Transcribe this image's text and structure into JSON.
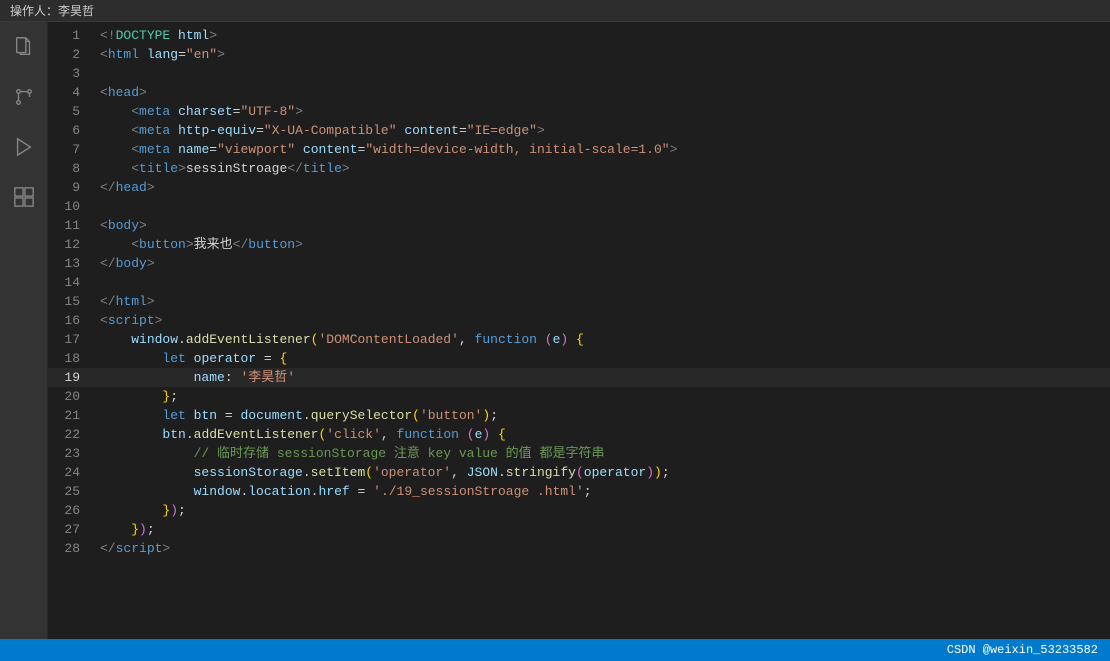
{
  "topbar": {
    "author_label": "操作人：李昊哲"
  },
  "activity": {
    "icons": [
      "files",
      "source-control",
      "debug",
      "extensions"
    ]
  },
  "lines": [
    {
      "num": 1,
      "content": "<span class='tag-angle'>&lt;!</span><span class='tag-name'>DOCTYPE</span> <span class='attr'>html</span><span class='tag-angle'>&gt;</span>"
    },
    {
      "num": 2,
      "content": "<span class='tag-angle'>&lt;</span><span class='tag-name-html'>html</span> <span class='attr'>lang</span><span class='op'>=</span><span class='val-str'>\"en\"</span><span class='tag-angle'>&gt;</span>"
    },
    {
      "num": 3,
      "content": ""
    },
    {
      "num": 4,
      "content": "<span class='tag-angle'>&lt;</span><span class='tag-name-html'>head</span><span class='tag-angle'>&gt;</span>"
    },
    {
      "num": 5,
      "content": "    <span class='tag-angle'>&lt;</span><span class='tag-name-html'>meta</span> <span class='attr'>charset</span><span class='op'>=</span><span class='val-str'>\"UTF-8\"</span><span class='tag-angle'>&gt;</span>"
    },
    {
      "num": 6,
      "content": "    <span class='tag-angle'>&lt;</span><span class='tag-name-html'>meta</span> <span class='attr'>http-equiv</span><span class='op'>=</span><span class='val-str'>\"X-UA-Compatible\"</span> <span class='attr'>content</span><span class='op'>=</span><span class='val-str'>\"IE=edge\"</span><span class='tag-angle'>&gt;</span>"
    },
    {
      "num": 7,
      "content": "    <span class='tag-angle'>&lt;</span><span class='tag-name-html'>meta</span> <span class='attr'>name</span><span class='op'>=</span><span class='val-str'>\"viewport\"</span> <span class='attr'>content</span><span class='op'>=</span><span class='val-str'>\"width=device-width, initial-scale=1.0\"</span><span class='tag-angle'>&gt;</span>"
    },
    {
      "num": 8,
      "content": "    <span class='tag-angle'>&lt;</span><span class='tag-name-html'>title</span><span class='tag-angle'>&gt;</span><span class='plain'>sessinStroage</span><span class='tag-angle'>&lt;/</span><span class='tag-name-html'>title</span><span class='tag-angle'>&gt;</span>"
    },
    {
      "num": 9,
      "content": "<span class='tag-angle'>&lt;/</span><span class='tag-name-html'>head</span><span class='tag-angle'>&gt;</span>"
    },
    {
      "num": 10,
      "content": ""
    },
    {
      "num": 11,
      "content": "<span class='tag-angle'>&lt;</span><span class='tag-name-html'>body</span><span class='tag-angle'>&gt;</span>"
    },
    {
      "num": 12,
      "content": "    <span class='tag-angle'>&lt;</span><span class='tag-name-html'>button</span><span class='tag-angle'>&gt;</span><span class='plain'>我来也</span><span class='tag-angle'>&lt;/</span><span class='tag-name-html'>button</span><span class='tag-angle'>&gt;</span>"
    },
    {
      "num": 13,
      "content": "<span class='tag-angle'>&lt;/</span><span class='tag-name-html'>body</span><span class='tag-angle'>&gt;</span>"
    },
    {
      "num": 14,
      "content": ""
    },
    {
      "num": 15,
      "content": "<span class='tag-angle'>&lt;/</span><span class='tag-name-html'>html</span><span class='tag-angle'>&gt;</span>"
    },
    {
      "num": 16,
      "content": "<span class='tag-angle'>&lt;</span><span class='tag-name-html'>script</span><span class='tag-angle'>&gt;</span>"
    },
    {
      "num": 17,
      "content": "    <span class='var'>window</span><span class='plain'>.</span><span class='fn'>addEventListener</span><span class='bracket'>(</span><span class='val-str'>'DOMContentLoaded'</span><span class='plain'>,</span> <span class='kw'>function</span> <span class='bracket2'>(</span><span class='var'>e</span><span class='bracket2'>)</span> <span class='bracket'>{</span>"
    },
    {
      "num": 18,
      "content": "        <span class='kw'>let</span> <span class='var'>operator</span> <span class='op'>=</span> <span class='bracket'>{</span>"
    },
    {
      "num": 19,
      "content": "            <span class='prop'>name</span><span class='plain'>:</span> <span class='val-str'>'李昊哲'</span>",
      "highlighted": true
    },
    {
      "num": 20,
      "content": "        <span class='bracket'>}</span><span class='plain'>;</span>"
    },
    {
      "num": 21,
      "content": "        <span class='kw'>let</span> <span class='var'>btn</span> <span class='op'>=</span> <span class='var'>document</span><span class='plain'>.</span><span class='fn'>querySelector</span><span class='bracket'>(</span><span class='val-str'>'button'</span><span class='bracket'>)</span><span class='plain'>;</span>"
    },
    {
      "num": 22,
      "content": "        <span class='var'>btn</span><span class='plain'>.</span><span class='fn'>addEventListener</span><span class='bracket'>(</span><span class='val-str'>'click'</span><span class='plain'>,</span> <span class='kw'>function</span> <span class='bracket2'>(</span><span class='var'>e</span><span class='bracket2'>)</span> <span class='bracket'>{</span>"
    },
    {
      "num": 23,
      "content": "            <span class='comment'>// 临时存储 sessionStorage 注意 key value 的值 都是字符串</span>"
    },
    {
      "num": 24,
      "content": "            <span class='var'>sessionStorage</span><span class='plain'>.</span><span class='fn'>setItem</span><span class='bracket'>(</span><span class='val-str'>'operator'</span><span class='plain'>,</span> <span class='var'>JSON</span><span class='plain'>.</span><span class='fn'>stringify</span><span class='bracket2'>(</span><span class='var'>operator</span><span class='bracket2'>)</span><span class='bracket'>)</span><span class='plain'>;</span>"
    },
    {
      "num": 25,
      "content": "            <span class='var'>window</span><span class='plain'>.</span><span class='var'>location</span><span class='plain'>.</span><span class='var'>href</span> <span class='op'>=</span> <span class='val-str'>'./19_sessionStroage .html'</span><span class='plain'>;</span>"
    },
    {
      "num": 26,
      "content": "        <span class='bracket'>}</span><span class='bracket2'>)</span><span class='plain'>;</span>"
    },
    {
      "num": 27,
      "content": "    <span class='bracket'>}</span><span class='bracket2'>)</span><span class='plain'>;</span>"
    },
    {
      "num": 28,
      "content": "<span class='tag-angle'>&lt;/</span><span class='tag-name-html'>script</span><span class='tag-angle'>&gt;</span>"
    }
  ],
  "bottombar": {
    "label": "CSDN @weixin_53233582"
  }
}
